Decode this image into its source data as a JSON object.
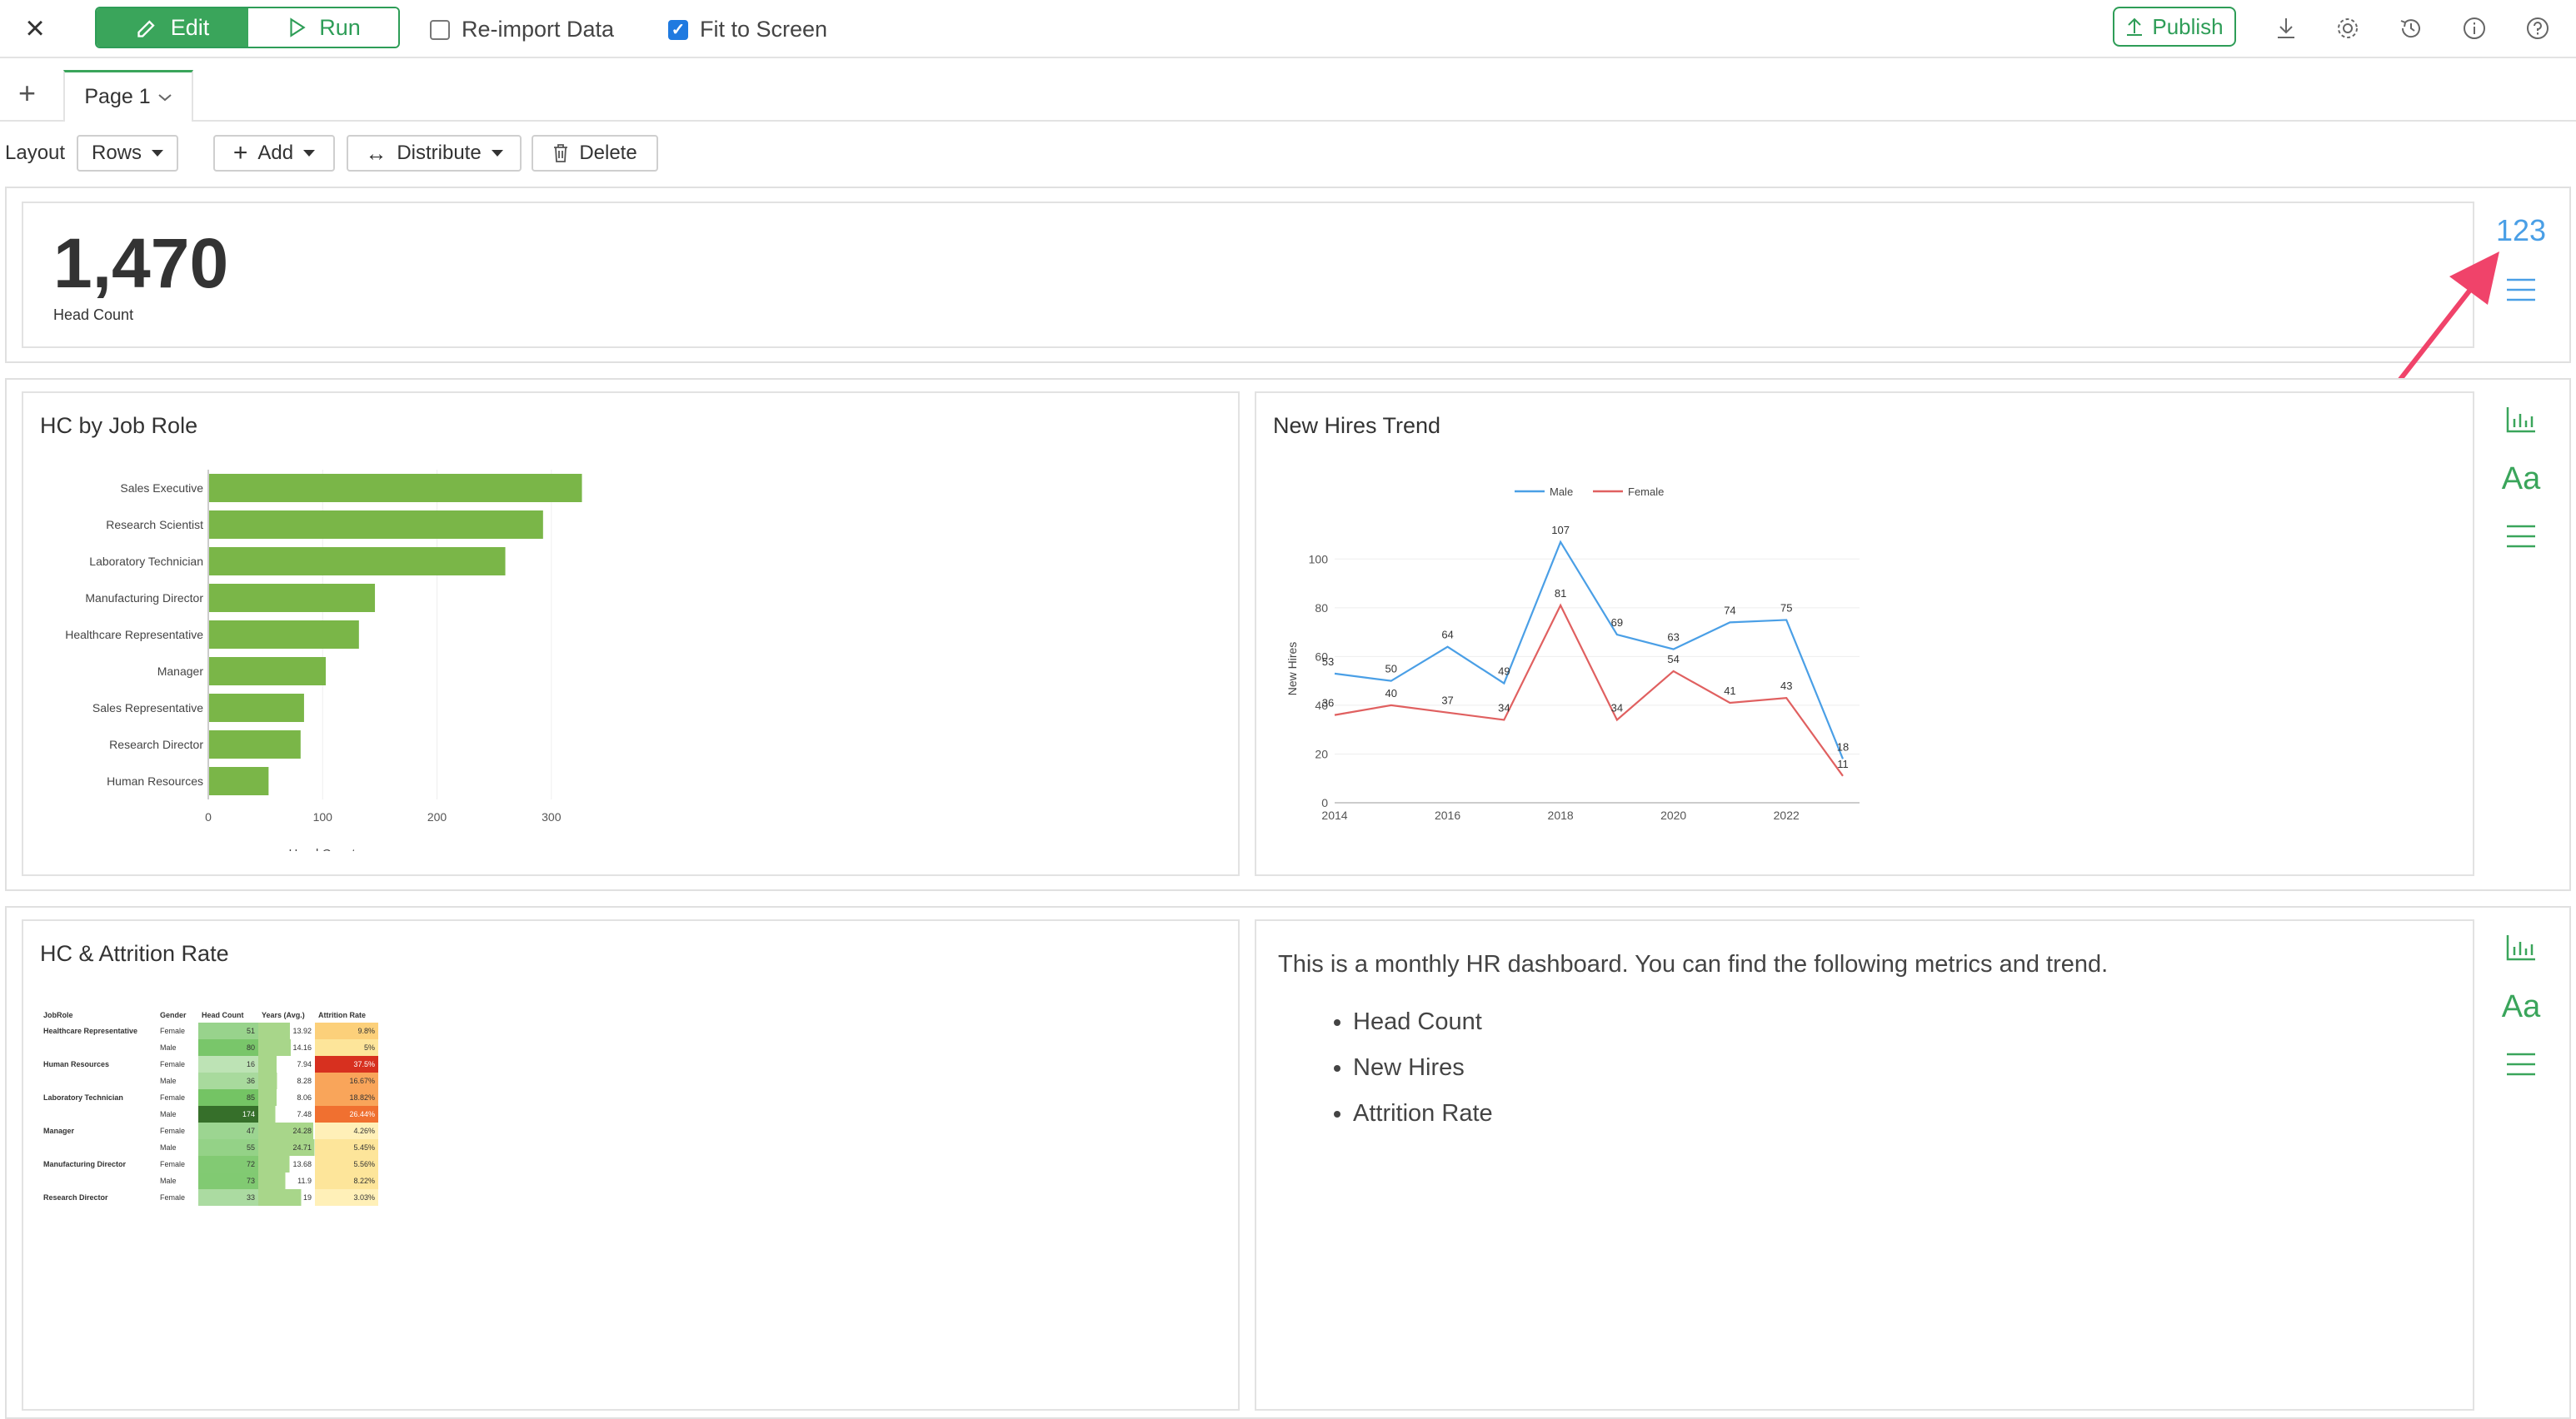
{
  "toolbar": {
    "edit_label": "Edit",
    "run_label": "Run",
    "reimport_label": "Re-import Data",
    "reimport_checked": false,
    "fit_label": "Fit to Screen",
    "fit_checked": true,
    "publish_label": "Publish"
  },
  "tabs": {
    "page_label": "Page 1"
  },
  "layout_bar": {
    "layout_label": "Layout",
    "rows_label": "Rows",
    "add_label": "Add",
    "distribute_label": "Distribute",
    "delete_label": "Delete"
  },
  "kpi": {
    "value": "1,470",
    "label": "Head Count"
  },
  "side_panel": {
    "number_type_label": "123",
    "text_type_label": "Aa"
  },
  "colors": {
    "accent": "#3aa55b",
    "bar": "#7ab648",
    "male": "#4a9fe6",
    "female": "#e06060",
    "arrow": "#f0436a"
  },
  "hc_by_role": {
    "title": "HC by Job Role",
    "chart_data": {
      "type": "bar",
      "orientation": "horizontal",
      "categories": [
        "Sales Executive",
        "Research Scientist",
        "Laboratory Technician",
        "Manufacturing Director",
        "Healthcare Representative",
        "Manager",
        "Sales Representative",
        "Research Director",
        "Human Resources"
      ],
      "values": [
        326,
        292,
        259,
        145,
        131,
        102,
        83,
        80,
        52
      ],
      "xlabel": "Head Count",
      "ylabel": "",
      "xlim": [
        0,
        330
      ],
      "xticks": [
        "0",
        "100",
        "200",
        "300"
      ]
    }
  },
  "new_hires": {
    "title": "New Hires Trend",
    "chart_data": {
      "type": "line",
      "x": [
        2014,
        2015,
        2016,
        2017,
        2018,
        2019,
        2020,
        2021,
        2022,
        2023
      ],
      "series": [
        {
          "name": "Male",
          "values": [
            53,
            50,
            64,
            49,
            107,
            69,
            63,
            74,
            75,
            18
          ]
        },
        {
          "name": "Female",
          "values": [
            36,
            40,
            37,
            34,
            81,
            34,
            54,
            41,
            43,
            11
          ]
        }
      ],
      "ylabel": "New Hires",
      "xlabel": "",
      "ylim": [
        0,
        110
      ],
      "yticks": [
        "0",
        "20",
        "40",
        "60",
        "80",
        "100"
      ],
      "xticks": [
        "2014",
        "2016",
        "2018",
        "2020",
        "2022"
      ],
      "legend": "top"
    }
  },
  "attrition": {
    "title": "HC & Attrition Rate",
    "headers": [
      "JobRole",
      "Gender",
      "Head Count",
      "Years (Avg.)",
      "Attrition Rate"
    ],
    "rows": [
      {
        "role": "Healthcare Representative",
        "gender": "Female",
        "hc": "51",
        "years": "13.92",
        "rate": "9.8%"
      },
      {
        "role": "",
        "gender": "Male",
        "hc": "80",
        "years": "14.16",
        "rate": "5%"
      },
      {
        "role": "Human Resources",
        "gender": "Female",
        "hc": "16",
        "years": "7.94",
        "rate": "37.5%"
      },
      {
        "role": "",
        "gender": "Male",
        "hc": "36",
        "years": "8.28",
        "rate": "16.67%"
      },
      {
        "role": "Laboratory Technician",
        "gender": "Female",
        "hc": "85",
        "years": "8.06",
        "rate": "18.82%"
      },
      {
        "role": "",
        "gender": "Male",
        "hc": "174",
        "years": "7.48",
        "rate": "26.44%"
      },
      {
        "role": "Manager",
        "gender": "Female",
        "hc": "47",
        "years": "24.28",
        "rate": "4.26%"
      },
      {
        "role": "",
        "gender": "Male",
        "hc": "55",
        "years": "24.71",
        "rate": "5.45%"
      },
      {
        "role": "Manufacturing Director",
        "gender": "Female",
        "hc": "72",
        "years": "13.68",
        "rate": "5.56%"
      },
      {
        "role": "",
        "gender": "Male",
        "hc": "73",
        "years": "11.9",
        "rate": "8.22%"
      },
      {
        "role": "Research Director",
        "gender": "Female",
        "hc": "33",
        "years": "19",
        "rate": "3.03%"
      }
    ]
  },
  "description": {
    "intro": "This is a monthly HR dashboard. You can find the following metrics and trend.",
    "items": [
      "Head Count",
      "New Hires",
      "Attrition Rate"
    ]
  }
}
